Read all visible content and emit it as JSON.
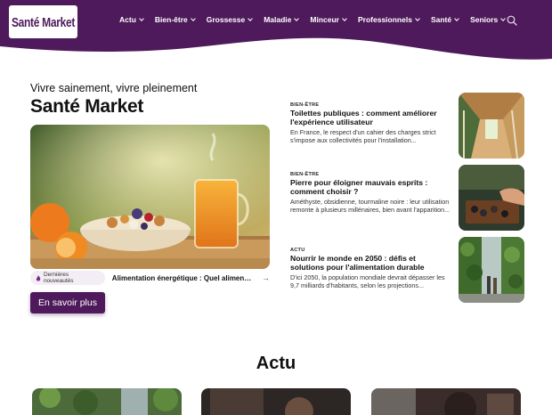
{
  "brand": {
    "logo_text": "Santé Market",
    "color_primary": "#4e1a5b"
  },
  "nav": {
    "items": [
      {
        "label": "Actu"
      },
      {
        "label": "Bien-être"
      },
      {
        "label": "Grossesse"
      },
      {
        "label": "Maladie"
      },
      {
        "label": "Minceur"
      },
      {
        "label": "Professionnels"
      },
      {
        "label": "Santé"
      },
      {
        "label": "Seniors"
      }
    ],
    "search_icon": "search-icon"
  },
  "hero": {
    "tagline": "Vivre sainement, vivre pleinement",
    "title": "Santé Market",
    "latest_label": "Dernières nouveautés",
    "latest_headline": "Alimentation énergétique : Quel aliment choisir ?",
    "cta_label": "En savoir plus"
  },
  "side_articles": [
    {
      "category": "BIEN-ÊTRE",
      "title": "Toilettes publiques : comment améliorer l'expérience utilisateur",
      "excerpt": "En France, le respect d'un cahier des charges strict s'impose aux collectivités pour l'installation..."
    },
    {
      "category": "BIEN-ÊTRE",
      "title": "Pierre pour éloigner mauvais esprits : comment choisir ?",
      "excerpt": "Améthyste, obsidienne, tourmaline noire : leur utilisation remonte à plusieurs millénaires, bien avant l'apparition..."
    },
    {
      "category": "ACTU",
      "title": "Nourrir le monde en 2050 : défis et solutions pour l'alimentation durable",
      "excerpt": "D'ici 2050, la population mondiale devrait dépasser les 9,7 milliards d'habitants, selon les projections..."
    }
  ],
  "section": {
    "title": "Actu"
  }
}
